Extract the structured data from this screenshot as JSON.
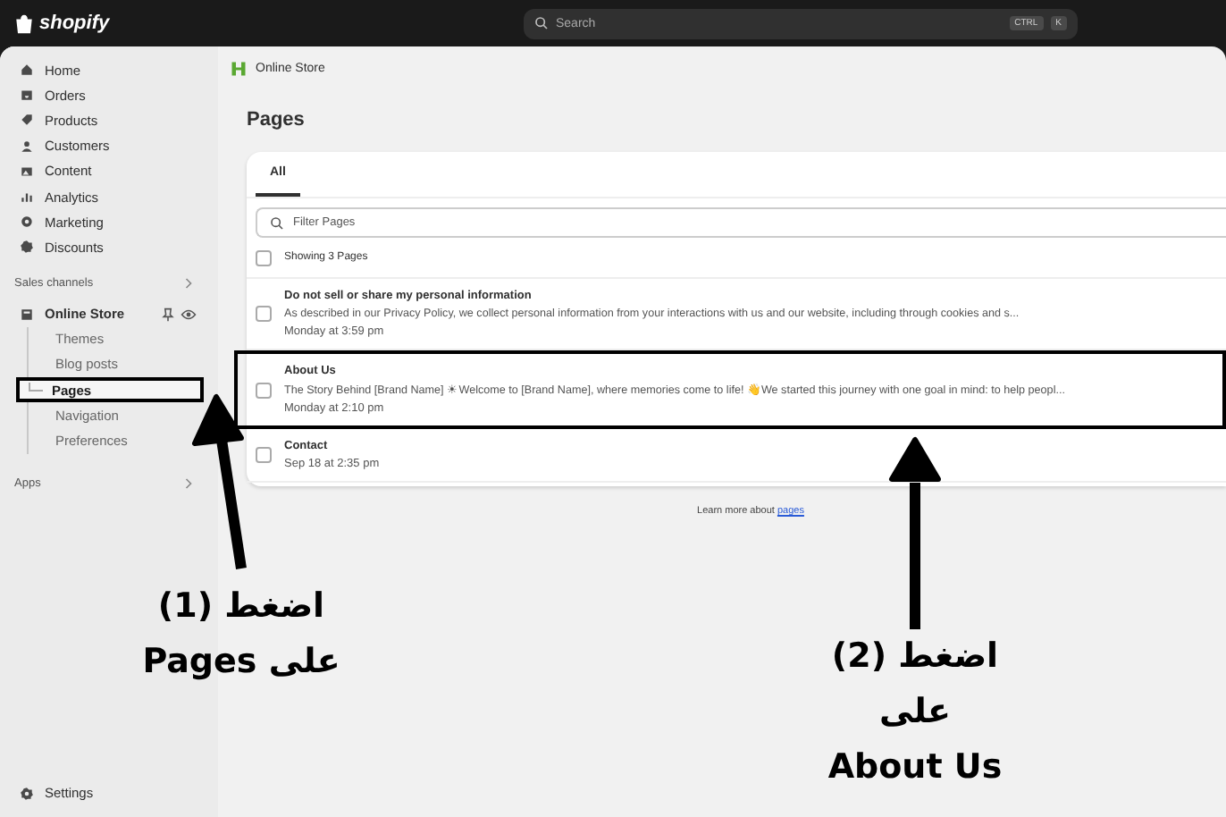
{
  "top_bar": {
    "logo": "shopify",
    "search": {
      "placeholder": "Search",
      "keys": [
        "CTRL",
        "K"
      ]
    }
  },
  "sidebar": {
    "items": [
      {
        "label": "Home",
        "selected": false
      },
      {
        "label": "Orders",
        "selected": false
      },
      {
        "label": "Products",
        "selected": false
      },
      {
        "label": "Customers",
        "selected": false
      },
      {
        "label": "Content",
        "selected": false
      },
      {
        "label": "Analytics",
        "selected": false
      },
      {
        "label": "Marketing",
        "selected": false
      },
      {
        "label": "Discounts",
        "selected": false
      }
    ],
    "sales_channels": {
      "label": "Sales channels",
      "channels": [
        {
          "label": "Online Store",
          "children": [
            {
              "label": "Themes",
              "selected": false,
              "highlighted": false
            },
            {
              "label": "Blog posts",
              "selected": false,
              "highlighted": false
            },
            {
              "label": "Pages",
              "selected": true,
              "highlighted": true
            },
            {
              "label": "Navigation",
              "selected": false,
              "highlighted": false
            },
            {
              "label": "Preferences",
              "selected": false,
              "highlighted": false
            }
          ]
        }
      ]
    },
    "apps": {
      "label": "Apps"
    },
    "settings": {
      "label": "Settings"
    }
  },
  "breadcrumb": "Online Store",
  "page_title": "Pages",
  "tabs": [
    {
      "label": "All",
      "selected": true
    }
  ],
  "filter": {
    "placeholder": "Filter Pages"
  },
  "list": {
    "summary": "Showing 3 Pages",
    "all_checked": false,
    "rows": [
      {
        "title": "Do not sell or share my personal information",
        "excerpt": "As described in our Privacy Policy, we collect personal information from your interactions with us and our website, including through cookies and s...",
        "date": "Monday at 3:59 pm",
        "checked": false,
        "highlighted": false
      },
      {
        "title": "About Us",
        "excerpt": "The Story Behind [Brand Name] ☀ Welcome to [Brand Name], where memories come to life! 👋We started this journey with one goal in mind: to help peopl...",
        "date": "Monday at 2:10 pm",
        "checked": false,
        "highlighted": true
      },
      {
        "title": "Contact",
        "date": "Sep 18 at 2:35 pm",
        "checked": false,
        "highlighted": false
      }
    ]
  },
  "footer": {
    "text": "Learn more about",
    "link": "pages"
  },
  "callouts": [
    {
      "lines": [
        "اضغط (1)",
        "على Pages"
      ]
    },
    {
      "lines": [
        "اضغط (2)",
        "على",
        "About Us"
      ]
    }
  ]
}
